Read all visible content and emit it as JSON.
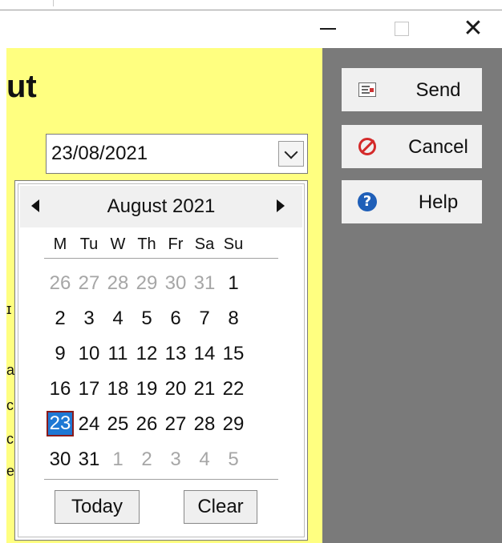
{
  "window": {
    "min_icon": "minimize-icon",
    "max_icon": "maximize-icon",
    "close_icon": "close-icon",
    "close_glyph": "✕"
  },
  "form": {
    "title_fragment": "ut",
    "left_edge_glyphs": [
      "ɪ",
      "a",
      "c",
      "c",
      "e"
    ]
  },
  "date_field": {
    "value": "23/08/2021",
    "dropdown_icon": "chevron-down-icon"
  },
  "calendar": {
    "month_label": "August 2021",
    "prev_icon": "triangle-left-icon",
    "next_icon": "triangle-right-icon",
    "weekdays": [
      "M",
      "Tu",
      "W",
      "Th",
      "Fr",
      "Sa",
      "Su"
    ],
    "weeks": [
      [
        {
          "d": "26",
          "m": true
        },
        {
          "d": "27",
          "m": true
        },
        {
          "d": "28",
          "m": true
        },
        {
          "d": "29",
          "m": true
        },
        {
          "d": "30",
          "m": true
        },
        {
          "d": "31",
          "m": true
        },
        {
          "d": "1",
          "m": false
        }
      ],
      [
        {
          "d": "2",
          "m": false
        },
        {
          "d": "3",
          "m": false
        },
        {
          "d": "4",
          "m": false
        },
        {
          "d": "5",
          "m": false
        },
        {
          "d": "6",
          "m": false
        },
        {
          "d": "7",
          "m": false
        },
        {
          "d": "8",
          "m": false
        }
      ],
      [
        {
          "d": "9",
          "m": false
        },
        {
          "d": "10",
          "m": false
        },
        {
          "d": "11",
          "m": false
        },
        {
          "d": "12",
          "m": false
        },
        {
          "d": "13",
          "m": false
        },
        {
          "d": "14",
          "m": false
        },
        {
          "d": "15",
          "m": false
        }
      ],
      [
        {
          "d": "16",
          "m": false
        },
        {
          "d": "17",
          "m": false
        },
        {
          "d": "18",
          "m": false
        },
        {
          "d": "19",
          "m": false
        },
        {
          "d": "20",
          "m": false
        },
        {
          "d": "21",
          "m": false
        },
        {
          "d": "22",
          "m": false
        }
      ],
      [
        {
          "d": "23",
          "m": false,
          "selected": true
        },
        {
          "d": "24",
          "m": false
        },
        {
          "d": "25",
          "m": false
        },
        {
          "d": "26",
          "m": false
        },
        {
          "d": "27",
          "m": false
        },
        {
          "d": "28",
          "m": false
        },
        {
          "d": "29",
          "m": false
        }
      ],
      [
        {
          "d": "30",
          "m": false
        },
        {
          "d": "31",
          "m": false
        },
        {
          "d": "1",
          "m": true
        },
        {
          "d": "2",
          "m": true
        },
        {
          "d": "3",
          "m": true
        },
        {
          "d": "4",
          "m": true
        },
        {
          "d": "5",
          "m": true
        }
      ]
    ],
    "today_label": "Today",
    "clear_label": "Clear"
  },
  "side_buttons": [
    {
      "label": "Send",
      "icon": "send-form-icon"
    },
    {
      "label": "Cancel",
      "icon": "cancel-icon"
    },
    {
      "label": "Help",
      "icon": "help-icon"
    }
  ],
  "colors": {
    "form_bg": "#ffff80",
    "panel_bg": "#7a7a7a",
    "selected_day": "#1e78d4"
  }
}
